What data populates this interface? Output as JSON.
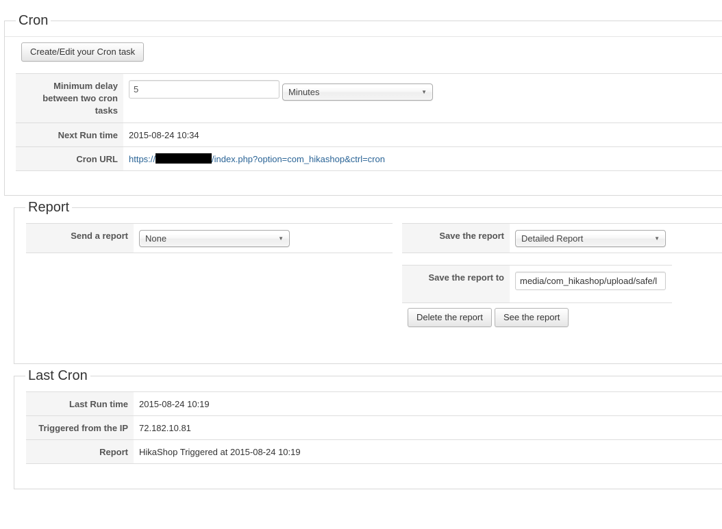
{
  "cron": {
    "legend": "Cron",
    "create_button": "Create/Edit your Cron task",
    "min_delay_label": "Minimum delay between two cron tasks",
    "min_delay_value": "5",
    "min_delay_unit": "Minutes",
    "next_run_label": "Next Run time",
    "next_run_value": "2015-08-24 10:34",
    "cron_url_label": "Cron URL",
    "cron_url_prefix": "https://",
    "cron_url_suffix": "/index.php?option=com_hikashop&ctrl=cron"
  },
  "report": {
    "legend": "Report",
    "send_label": "Send a report",
    "send_value": "None",
    "save_label": "Save the report",
    "save_value": "Detailed Report",
    "save_to_label": "Save the report to",
    "save_to_value": "media/com_hikashop/upload/safe/l",
    "delete_button": "Delete the report",
    "see_button": "See the report"
  },
  "last_cron": {
    "legend": "Last Cron",
    "last_run_label": "Last Run time",
    "last_run_value": "2015-08-24 10:19",
    "ip_label": "Triggered from the IP",
    "ip_value": "72.182.10.81",
    "report_label": "Report",
    "report_value": "HikaShop Triggered at 2015-08-24 10:19"
  },
  "icons": {
    "dropdown": "caret-down-icon"
  },
  "colors": {
    "link": "#2a6496",
    "label_bg": "#f5f5f5",
    "border": "#dddddd"
  }
}
